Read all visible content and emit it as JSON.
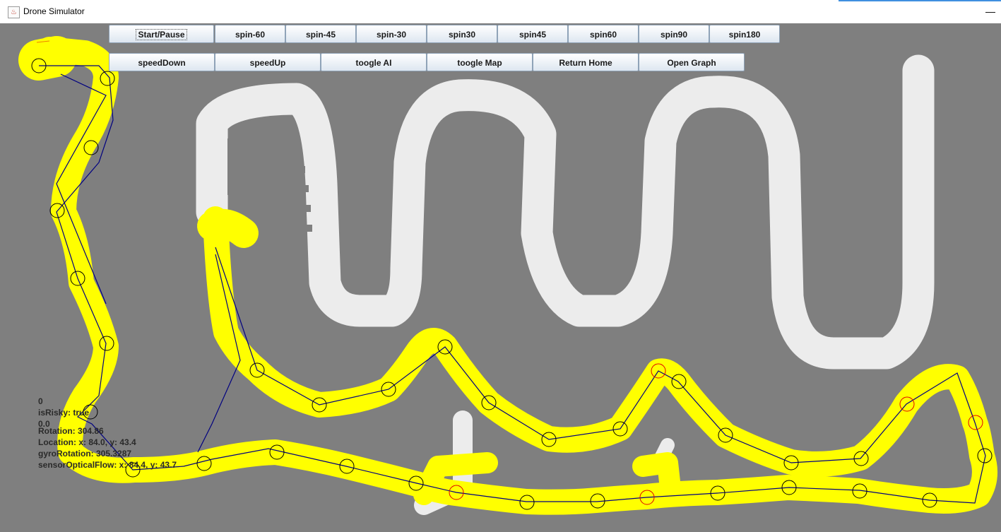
{
  "window": {
    "title": "Drone Simulator",
    "minimize_glyph": "—",
    "icon": "java-cup-icon"
  },
  "toolbar": {
    "row1": [
      "Start/Pause",
      "spin-60",
      "spin-45",
      "spin-30",
      "spin30",
      "spin45",
      "spin60",
      "spin90",
      "spin180"
    ],
    "row2": [
      "speedDown",
      "speedUp",
      "toogle AI",
      "toogle Map",
      "Return Home",
      "Open Graph"
    ]
  },
  "status": {
    "line1": "0",
    "line2": "isRisky: true",
    "line3": "0.0",
    "rotation": "Rotation: 304.86",
    "location": "Location: x: 84.0, y: 43.4",
    "gyro": "gyroRotation: 305.3287",
    "optical": "sensorOpticalFlow: x: 84.4, y: 43.7"
  },
  "colors": {
    "wall": "#7f7f7f",
    "unexplored": "#ececec",
    "explored": "#ffff00",
    "path": "#000080",
    "waypoint": "#000000",
    "risky_waypoint": "#e00000"
  }
}
